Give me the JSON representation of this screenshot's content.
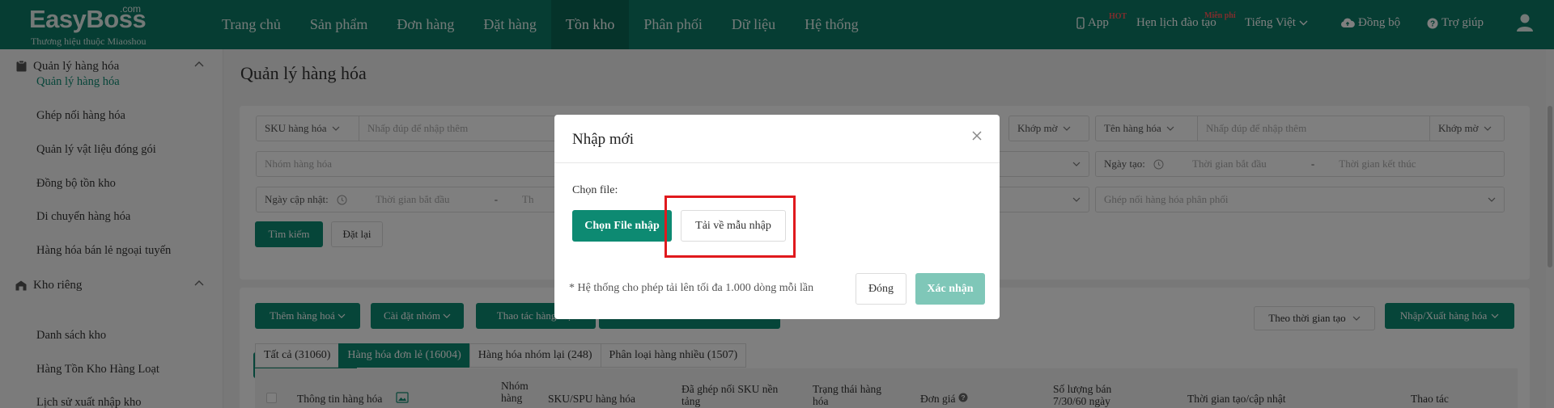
{
  "header": {
    "logo_name": "EasyBoss",
    "logo_com": ".com",
    "logo_tagline": "Thương hiệu thuộc Miaoshou",
    "nav": [
      {
        "label": "Trang chủ",
        "active": false
      },
      {
        "label": "Sản phẩm",
        "active": false
      },
      {
        "label": "Đơn hàng",
        "active": false
      },
      {
        "label": "Đặt hàng",
        "active": false
      },
      {
        "label": "Tồn kho",
        "active": true
      },
      {
        "label": "Phân phối",
        "active": false
      },
      {
        "label": "Dữ liệu",
        "active": false
      },
      {
        "label": "Hệ thống",
        "active": false
      }
    ],
    "app_label": "App",
    "app_badge": "HOT",
    "schedule_label": "Hẹn lịch đào tạo",
    "schedule_badge": "Miễn phí",
    "language": "Tiếng Việt",
    "sync_label": "Đồng bộ",
    "help_label": "Trợ giúp"
  },
  "sidebar": {
    "group1": {
      "label": "Quản lý hàng hóa"
    },
    "group1_items": [
      {
        "label": "Quản lý hàng hóa",
        "active": true
      },
      {
        "label": "Ghép nối hàng hóa"
      },
      {
        "label": "Quản lý vật liệu đóng gói"
      },
      {
        "label": "Đồng bộ tồn kho"
      },
      {
        "label": "Di chuyển hàng hóa"
      },
      {
        "label": "Hàng hóa bán lẻ ngoại tuyến"
      }
    ],
    "group2": {
      "label": "Kho riêng"
    },
    "group2_items": [
      {
        "label": "Danh sách kho"
      },
      {
        "label": "Hàng Tồn Kho Hàng Loạt"
      },
      {
        "label": "Lịch sử xuất nhập kho"
      }
    ]
  },
  "main": {
    "title": "Quản lý hàng hóa",
    "filters": {
      "sku_select": "SKU hàng hóa",
      "sku_placeholder": "Nhấp đúp để nhập thêm",
      "match_mode_1": "Khớp mờ",
      "name_select": "Tên hàng hóa",
      "name_placeholder": "Nhấp đúp để nhập thêm",
      "match_mode_2": "Khớp mờ",
      "group_placeholder": "Nhóm hàng hóa",
      "created_label": "Ngày tạo:",
      "start_placeholder": "Thời gian bắt đầu",
      "dash": "-",
      "end_placeholder": "Thời gian kết thúc",
      "updated_label": "Ngày cập nhật:",
      "updated_start": "Thời gian bắt đầu",
      "updated_end_partial": "Th",
      "distribution_placeholder": "Ghép nối hàng hóa phân phối",
      "search_button": "Tìm kiếm",
      "reset_button": "Đặt lại"
    },
    "toolbar": {
      "add": "Thêm hàng hoá",
      "group_settings": "Cài đặt nhóm",
      "batch_ops": "Thao tác hàng loạt",
      "sort": "Theo thời gian tạo",
      "import_export": "Nhập/Xuất hàng hóa"
    },
    "tabs": [
      {
        "label": "Tất cả (31060)",
        "active": false
      },
      {
        "label": "Hàng hóa đơn lẻ (16004)",
        "active": true
      },
      {
        "label": "Hàng hóa nhóm lại (248)",
        "active": false
      },
      {
        "label": "Phân loại hàng nhiều (1507)",
        "active": false
      }
    ],
    "columns": {
      "info": "Thông tin hàng hóa",
      "group_l1": "Nhóm",
      "group_l2": "hàng",
      "sku": "SKU/SPU hàng hóa",
      "paired_l1": "Đã ghép nối SKU nền",
      "paired_l2": "tảng",
      "status_l1": "Trạng thái hàng",
      "status_l2": "hóa",
      "price": "Đơn giá",
      "sold_l1": "Số lượng bán",
      "sold_l2": "7/30/60 ngày",
      "time": "Thời gian tạo/cập nhật",
      "actions": "Thao tác"
    }
  },
  "dialog": {
    "title": "Nhập mới",
    "file_label": "Chọn file:",
    "choose_button": "Chọn File nhập",
    "download_button": "Tải về mẫu nhập",
    "note": "* Hệ thống cho phép tải lên tối đa 1.000 dòng mỗi lần",
    "close_button": "Đóng",
    "confirm_button": "Xác nhận"
  },
  "colors": {
    "brand": "#0d7a66",
    "primary": "#0d8a72",
    "confirm_disabled": "#7fc7b8",
    "highlight": "#e0191d"
  }
}
